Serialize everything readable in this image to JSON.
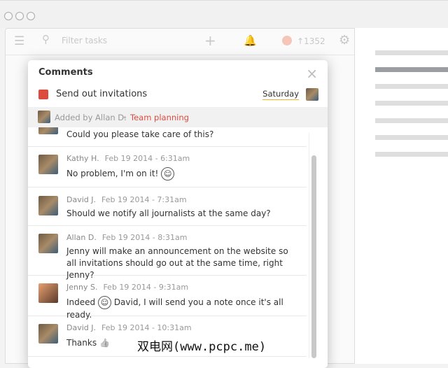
{
  "app": {
    "filter_placeholder": "Filter tasks",
    "karma": "↑1352"
  },
  "modal": {
    "title": "Comments",
    "close": "×",
    "task": {
      "name": "Send out invitations",
      "date": "Saturday",
      "color": "#db4c3f"
    },
    "added_by": "Added by Allan D.",
    "separator": "•",
    "project": "Team planning",
    "comments": [
      {
        "text": "Could you please take care of this?"
      },
      {
        "author": "Kathy H.",
        "time": "Feb 19 2014 - 6:31am",
        "text": "No problem, I'm on it!",
        "emoji": "☺"
      },
      {
        "author": "David J.",
        "time": "Feb 19 2014 - 7:31am",
        "text": "Should we notify all journalists at the same day?"
      },
      {
        "author": "Allan D.",
        "time": "Feb 19 2014 - 8:31am",
        "text": "Jenny will make an announcement on the website so all invitations should go out at the same time, right Jenny?"
      },
      {
        "author": "Jenny S.",
        "time": "Feb 19 2014 - 9:31am",
        "text_before": "Indeed",
        "emoji": "☺",
        "text_after": "David, I will send you a note once it's all ready."
      },
      {
        "author": "David J.",
        "time": "Feb 19 2014 - 10:31am",
        "text": "Thanks",
        "emoji": "👍"
      }
    ]
  },
  "watermark": "双电网(www.pcpc.me)"
}
